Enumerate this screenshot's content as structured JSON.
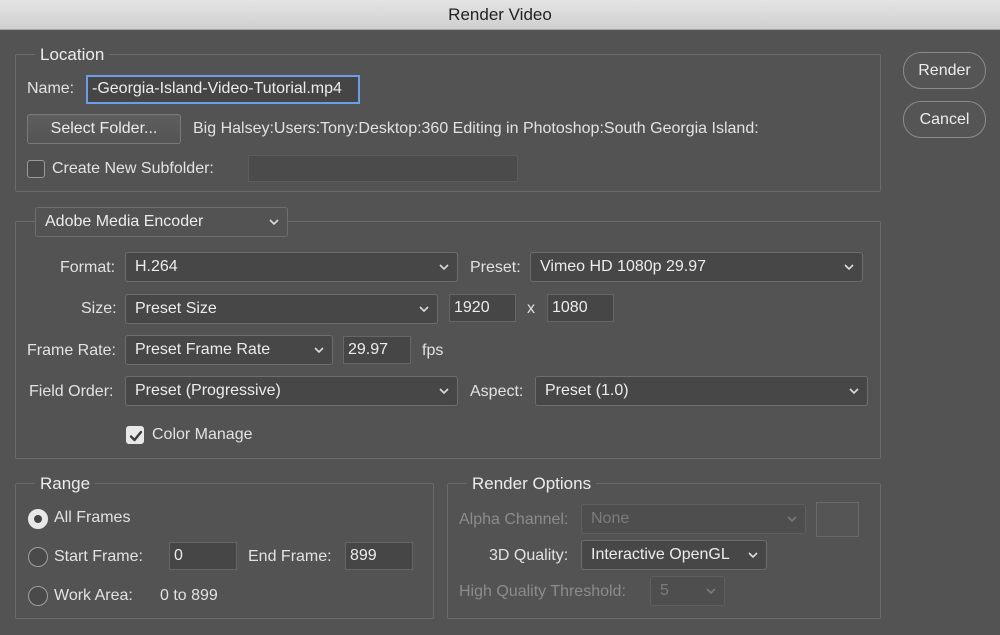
{
  "window": {
    "title": "Render Video"
  },
  "actions": {
    "render_label": "Render",
    "cancel_label": "Cancel"
  },
  "location": {
    "legend": "Location",
    "name_label": "Name:",
    "name_value": "-Georgia-Island-Video-Tutorial.mp4",
    "select_folder_label": "Select Folder...",
    "folder_path": "Big Halsey:Users:Tony:Desktop:360 Editing in Photoshop:South Georgia Island:",
    "subfolder_label": "Create New Subfolder:",
    "subfolder_checked": false,
    "subfolder_value": ""
  },
  "encoder": {
    "selected": "Adobe Media Encoder",
    "format_label": "Format:",
    "format_value": "H.264",
    "preset_label": "Preset:",
    "preset_value": "Vimeo HD 1080p 29.97",
    "size_label": "Size:",
    "size_value": "Preset Size",
    "width": "1920",
    "x_sep": "x",
    "height": "1080",
    "frame_rate_label": "Frame Rate:",
    "frame_rate_value": "Preset Frame Rate",
    "fps_value": "29.97",
    "fps_unit": "fps",
    "field_order_label": "Field Order:",
    "field_order_value": "Preset (Progressive)",
    "aspect_label": "Aspect:",
    "aspect_value": "Preset (1.0)",
    "color_manage_label": "Color Manage",
    "color_manage_checked": true
  },
  "range": {
    "legend": "Range",
    "all_frames_label": "All Frames",
    "start_frame_label": "Start Frame:",
    "start_frame_value": "0",
    "end_frame_label": "End Frame:",
    "end_frame_value": "899",
    "work_area_label": "Work Area:",
    "work_area_value": "0 to 899",
    "selected": "All Frames"
  },
  "render_options": {
    "legend": "Render Options",
    "alpha_label": "Alpha Channel:",
    "alpha_value": "None",
    "quality_label": "3D Quality:",
    "quality_value": "Interactive OpenGL",
    "threshold_label": "High Quality Threshold:",
    "threshold_value": "5"
  },
  "colors": {
    "background": "#535353",
    "focus_ring": "#6a9ee8",
    "titlebar": "#d8d8d8"
  }
}
